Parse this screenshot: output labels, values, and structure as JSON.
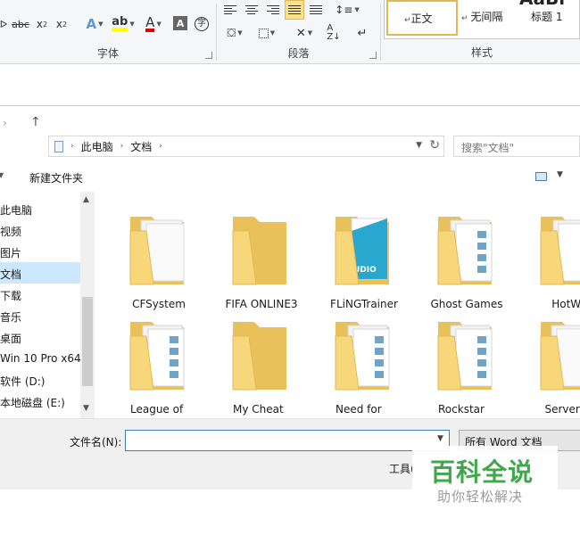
{
  "ribbon": {
    "font_group": "字体",
    "paragraph_group": "段落",
    "styles_group": "样式",
    "styles": [
      "正文",
      "无间隔",
      "标题 1"
    ],
    "heading_glimpse": "AaBl"
  },
  "address": {
    "crumbs": [
      "此电脑",
      "文档"
    ],
    "search_placeholder": "搜索\"文档\""
  },
  "toolbar": {
    "new_folder": "新建文件夹"
  },
  "nav_items": [
    "此电脑",
    "视频",
    "图片",
    "文档",
    "下载",
    "音乐",
    "桌面",
    "Win 10 Pro x64",
    "软件 (D:)",
    "本地磁盘 (E:)"
  ],
  "files": [
    {
      "name": "CFSystem",
      "type": "folder-docs"
    },
    {
      "name": "FIFA ONLINE3",
      "type": "folder-empty"
    },
    {
      "name": "FLiNGTrainer",
      "type": "folder-audio"
    },
    {
      "name": "Ghost Games",
      "type": "folder-pics"
    },
    {
      "name": "HotWa",
      "type": "folder-pics"
    },
    {
      "name": "League of\nLegends",
      "type": "folder-pics"
    },
    {
      "name": "My Cheat\nTables",
      "type": "folder-empty"
    },
    {
      "name": "Need for\nSpeed(TM)",
      "type": "folder-pics"
    },
    {
      "name": "Rockstar\nGames",
      "type": "folder-pics"
    },
    {
      "name": "ServerCo",
      "type": "folder-docs"
    }
  ],
  "bottom": {
    "filename_label": "文件名(N):",
    "filename_value": "",
    "filetype": "所有 Word 文档",
    "tools_label": "工具("
  },
  "watermark": {
    "title": "百科全说",
    "subtitle": "助你轻松解决"
  },
  "colors": {
    "selection": "#cce8ff",
    "accent": "#3c7fb1",
    "folder": "#f7d77a",
    "watermark_green": "#3fa84a"
  }
}
